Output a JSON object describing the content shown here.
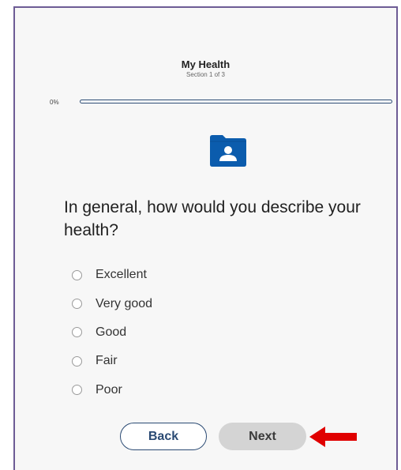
{
  "survey": {
    "title": "My Health",
    "section_label": "Section 1 of 3",
    "progress_text": "0%",
    "progress_fraction": 0
  },
  "question": {
    "text": "In general, how would you describe your health?",
    "icon": "folder-person-icon",
    "options": [
      {
        "label": "Excellent",
        "selected": false
      },
      {
        "label": "Very good",
        "selected": false
      },
      {
        "label": "Good",
        "selected": false
      },
      {
        "label": "Fair",
        "selected": false
      },
      {
        "label": "Poor",
        "selected": false
      }
    ]
  },
  "buttons": {
    "back_label": "Back",
    "next_label": "Next"
  },
  "annotation": {
    "arrow_icon": "red-arrow-left-icon"
  },
  "colors": {
    "brand_navy": "#2a4a73",
    "icon_blue": "#0b5cad",
    "arrow_red": "#e00000",
    "next_button_bg": "#d4d4d4",
    "frame_border": "#6d5c95"
  }
}
